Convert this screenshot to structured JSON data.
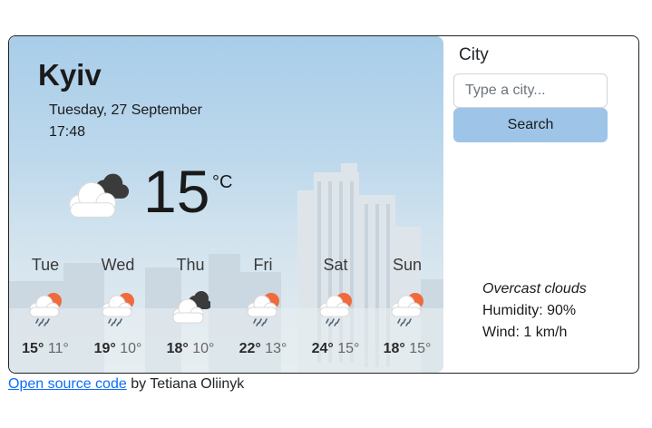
{
  "weather": {
    "city": "Kyiv",
    "date": "Tuesday, 27 September",
    "time": "17:48",
    "current_icon": "broken-clouds-icon",
    "temperature": "15",
    "unit": "°C",
    "description": "Overcast clouds",
    "humidity": "Humidity: 90%",
    "wind": "Wind: 1 km/h"
  },
  "forecast": [
    {
      "day": "Tue",
      "icon": "rain-icon",
      "max": "15°",
      "min": "11°"
    },
    {
      "day": "Wed",
      "icon": "rain-icon",
      "max": "19°",
      "min": "10°"
    },
    {
      "day": "Thu",
      "icon": "broken-clouds-icon",
      "max": "18°",
      "min": "10°"
    },
    {
      "day": "Fri",
      "icon": "rain-icon",
      "max": "22°",
      "min": "13°"
    },
    {
      "day": "Sat",
      "icon": "rain-icon",
      "max": "24°",
      "min": "15°"
    },
    {
      "day": "Sun",
      "icon": "rain-icon",
      "max": "18°",
      "min": "15°"
    }
  ],
  "search": {
    "label": "City",
    "placeholder": "Type a city...",
    "value": "",
    "button_label": "Search"
  },
  "footer": {
    "link_text": "Open source code",
    "author_text": " by Tetiana Oliinyk"
  },
  "colors": {
    "button": "#9ec5e8",
    "link": "#0d6efd",
    "sun": "#f06a3c",
    "cloud_dark": "#3a3a3a",
    "rain": "#556677"
  }
}
